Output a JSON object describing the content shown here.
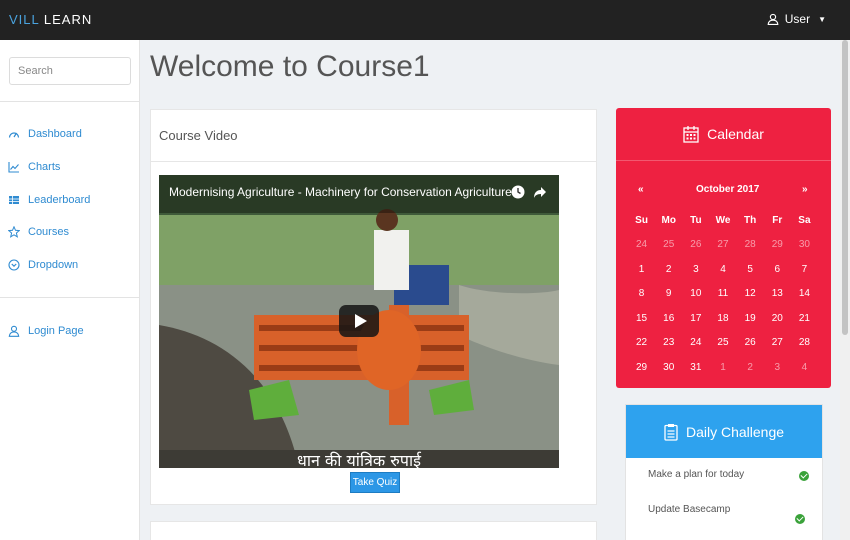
{
  "brand": {
    "part1": "VILL",
    "part2": " LEARN"
  },
  "user": {
    "label": "User"
  },
  "search": {
    "placeholder": "Search"
  },
  "nav": [
    {
      "label": "Dashboard",
      "icon": "dashboard-icon"
    },
    {
      "label": "Charts",
      "icon": "chart-icon"
    },
    {
      "label": "Leaderboard",
      "icon": "table-icon"
    },
    {
      "label": "Courses",
      "icon": "star-icon"
    },
    {
      "label": "Dropdown",
      "icon": "chevron-circle-icon"
    },
    {
      "label": "Login Page",
      "icon": "user-icon"
    }
  ],
  "page": {
    "title": "Welcome to Course1"
  },
  "video_panel": {
    "heading": "Course Video",
    "video_title": "Modernising Agriculture - Machinery for Conservation Agriculture",
    "quiz_button": "Take Quiz"
  },
  "calendar": {
    "title": "Calendar",
    "month": "October 2017",
    "prev": "«",
    "next": "»",
    "days": [
      "Su",
      "Mo",
      "Tu",
      "We",
      "Th",
      "Fr",
      "Sa"
    ],
    "weeks": [
      [
        "24",
        "25",
        "26",
        "27",
        "28",
        "29",
        "30"
      ],
      [
        "1",
        "2",
        "3",
        "4",
        "5",
        "6",
        "7"
      ],
      [
        "8",
        "9",
        "10",
        "11",
        "12",
        "13",
        "14"
      ],
      [
        "15",
        "16",
        "17",
        "18",
        "19",
        "20",
        "21"
      ],
      [
        "22",
        "23",
        "24",
        "25",
        "26",
        "27",
        "28"
      ],
      [
        "29",
        "30",
        "31",
        "1",
        "2",
        "3",
        "4"
      ]
    ]
  },
  "challenge": {
    "title": "Daily Challenge",
    "tasks": [
      "Make a plan for today",
      "Update Basecamp"
    ]
  },
  "colors": {
    "accent": "#2f8bd1",
    "calendar": "#ee2141",
    "challenge": "#2ea2ee",
    "topbar": "#222222"
  }
}
